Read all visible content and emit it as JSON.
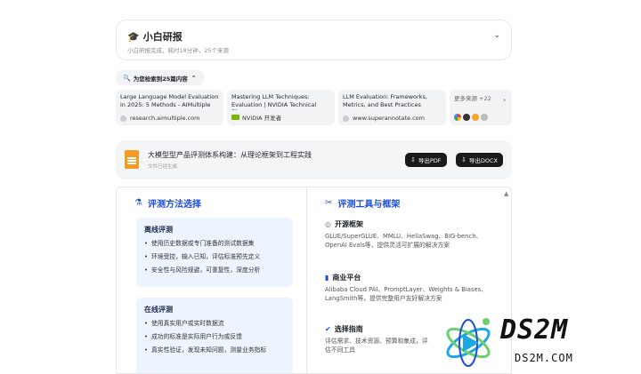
{
  "header": {
    "title": "小白研报",
    "subtitle": "小白研报完成，耗时18分钟，25个来源"
  },
  "search": {
    "label": "为您检索到25篇内容"
  },
  "sources": [
    {
      "title": "Large Language Model Evaluation in 2025: 5 Methods - AIMultiple",
      "domain": "research.aimultiple.com"
    },
    {
      "title": "Mastering LLM Techniques: Evaluation | NVIDIA Technical Blog",
      "domain": "NVIDIA 开发者"
    },
    {
      "title": "LLM Evaluation: Frameworks, Metrics, and Best Practices",
      "domain": "www.superannotate.com"
    }
  ],
  "more_sources": {
    "label": "更多来源 +22"
  },
  "document": {
    "title": "大模型型产品评测体系构建：从理论框架到工程实践",
    "subtitle": "文件已经生成",
    "export_pdf": "导出PDF",
    "export_docx": "导出DOCX"
  },
  "left": {
    "heading": "评测方法选择",
    "offline": {
      "title": "离线评测",
      "items": [
        "使用历史数据或专门准备的测试数据集",
        "环境受控，输入已知，评估标准预先定义",
        "安全性与风险规避，可重复性，深度分析"
      ]
    },
    "online": {
      "title": "在线评测",
      "items": [
        "使用真实用户或实时数据流",
        "成功的标准是实际用户行为或反馈",
        "真实性验证，发现未知问题，测量业务指标"
      ]
    }
  },
  "right": {
    "heading": "评测工具与框架",
    "open_source": {
      "title": "开源框架",
      "desc": "GLUE/SuperGLUE、MMLU、HellaSwag、BIG-bench、OpenAI Evals等，提供灵活可扩展的解决方案"
    },
    "commercial": {
      "title": "商业平台",
      "desc": "Alibaba Cloud PAI、PromptLayer、Weights & Biases、LangSmith等，提供完整用户友好解决方案"
    },
    "guide": {
      "title": "选择指南",
      "desc": "评估需求、技术资源、预算和集成，评估不同工具"
    }
  },
  "watermark": {
    "text": "DS2M",
    "sub": "DS2M.COM"
  },
  "colors": {
    "accent": "#1d4ed8",
    "doc_icon": "#f59a23",
    "box_bg": "#eef4ff"
  }
}
